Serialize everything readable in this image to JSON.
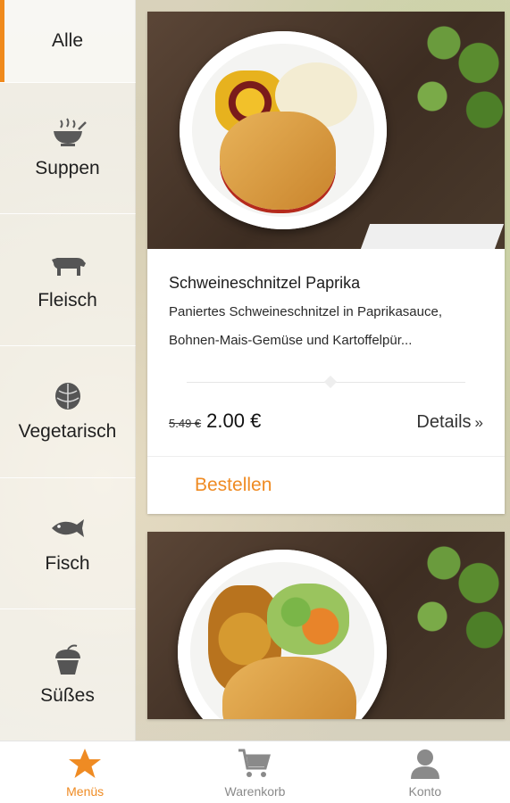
{
  "sidebar": {
    "items": [
      {
        "label": "Alle",
        "icon": "none"
      },
      {
        "label": "Suppen",
        "icon": "soup-bowl-icon"
      },
      {
        "label": "Fleisch",
        "icon": "cow-icon"
      },
      {
        "label": "Vegetarisch",
        "icon": "artichoke-icon"
      },
      {
        "label": "Fisch",
        "icon": "fish-icon"
      },
      {
        "label": "Süßes",
        "icon": "cupcake-icon"
      }
    ]
  },
  "menu": {
    "item1": {
      "title": "Schweineschnitzel Paprika",
      "description": "Paniertes Schweineschnitzel in Paprikasauce, Bohnen-Mais-Gemüse und Kartoffelpür...",
      "old_price": "5.49 €",
      "price": "2.00 €",
      "details_label": "Details",
      "details_chevron": "»",
      "order_label": "Bestellen"
    }
  },
  "nav": {
    "items": [
      {
        "label": "Menüs",
        "icon": "star-icon",
        "active": true
      },
      {
        "label": "Warenkorb",
        "icon": "cart-icon",
        "active": false
      },
      {
        "label": "Konto",
        "icon": "person-icon",
        "active": false
      }
    ]
  },
  "colors": {
    "accent": "#ef8b23",
    "icon_gray": "#555555",
    "nav_gray": "#8a8a8a"
  }
}
